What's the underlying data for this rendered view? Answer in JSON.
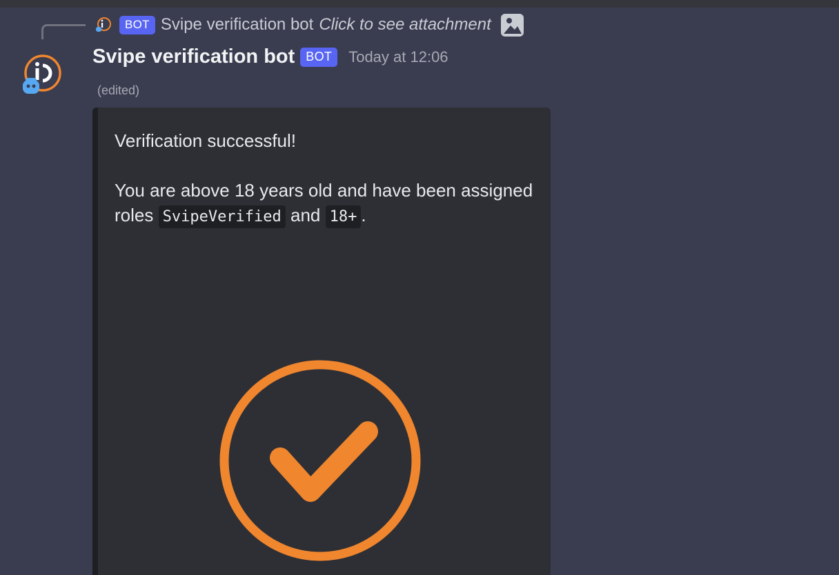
{
  "reply": {
    "bot_tag": "BOT",
    "author": "Svipe verification bot",
    "preview": "Click to see attachment",
    "attachment_icon": "image-icon"
  },
  "message": {
    "author": "Svipe verification bot",
    "bot_tag": "BOT",
    "timestamp": "Today at 12:06",
    "edited": "(edited)"
  },
  "embed": {
    "title_line": "Verification successful!",
    "body_prefix": "You are above 18 years old and have been assigned roles",
    "role_1": "SvipeVerified",
    "joiner": "and",
    "role_2": "18+",
    "suffix": ".",
    "image_icon": "checkmark-circle-icon"
  },
  "colors": {
    "background": "#3a3c50",
    "embed_bg": "#2e2f35",
    "bot_tag": "#5865f2",
    "accent_orange": "#f0862e",
    "bot_badge_blue": "#57a8f2"
  }
}
